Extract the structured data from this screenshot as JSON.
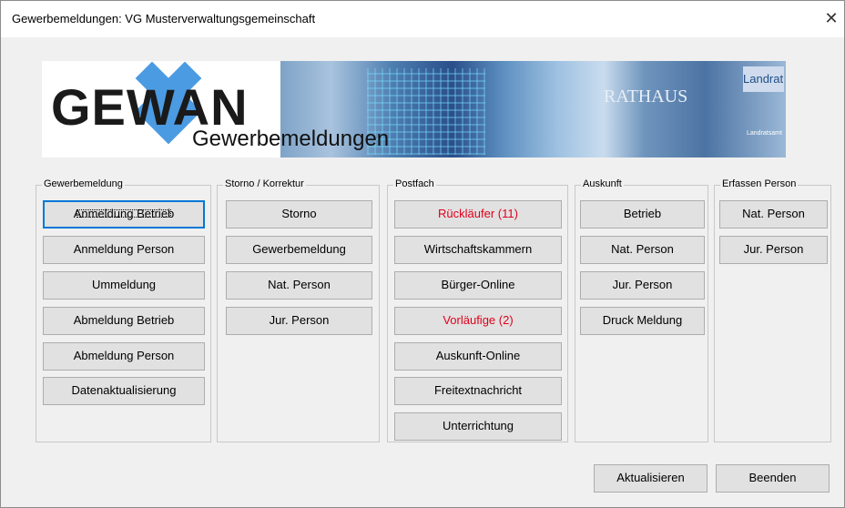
{
  "window": {
    "title": "Gewerbemeldungen: VG Musterverwaltungsgemeinschaft",
    "close_label": "✕"
  },
  "banner": {
    "logo": "GEWAN",
    "subtitle": "Gewerbemeldungen",
    "rathaus": "RATHAUS",
    "landrat": "Landrat",
    "landratsamt": "Landratsamt"
  },
  "groups": {
    "gewerbemeldung": {
      "legend": "Gewerbemeldung",
      "buttons": [
        "Anmeldung Betrieb",
        "Anmeldung Person",
        "Ummeldung",
        "Abmeldung Betrieb",
        "Abmeldung Person",
        "Datenaktualisierung"
      ]
    },
    "storno": {
      "legend": "Storno / Korrektur",
      "buttons": [
        "Storno",
        "Gewerbemeldung",
        "Nat. Person",
        "Jur. Person"
      ]
    },
    "postfach": {
      "legend": "Postfach",
      "buttons": [
        "Rückläufer (11)",
        "Wirtschaftskammern",
        "Bürger-Online",
        "Vorläufige (2)",
        "Auskunft-Online",
        "Freitextnachricht",
        "Unterrichtung"
      ]
    },
    "auskunft": {
      "legend": "Auskunft",
      "buttons": [
        "Betrieb",
        "Nat. Person",
        "Jur. Person",
        "Druck Meldung"
      ]
    },
    "erfassen": {
      "legend": "Erfassen Person",
      "buttons": [
        "Nat. Person",
        "Jur. Person"
      ]
    }
  },
  "footer": {
    "refresh_label": "Aktualisieren",
    "exit_label": "Beenden"
  },
  "colors": {
    "alert_text": "#e0001b",
    "focus": "#0078d7",
    "logo_blue": "#4b9be3"
  }
}
